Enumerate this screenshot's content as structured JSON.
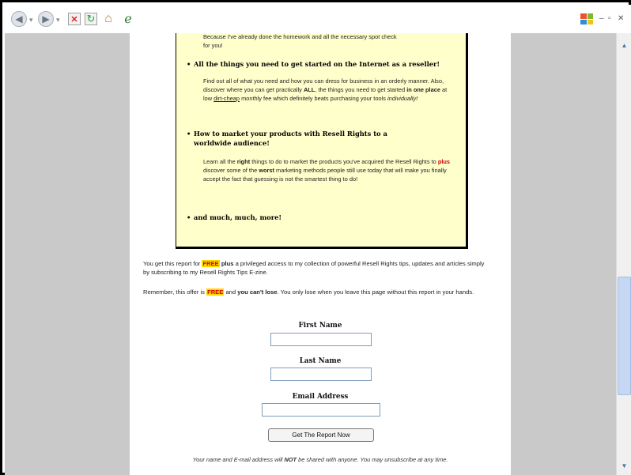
{
  "browser": {
    "back_glyph": "◀",
    "back_arrow": "▾",
    "forward_glyph": "▶",
    "forward_arrow": "▾",
    "stop_glyph": "✕",
    "refresh_glyph": "↻",
    "home_glyph": "⌂",
    "ie_glyph": "ℯ",
    "minimize_glyph": "–",
    "restore_glyph": "▫",
    "close_glyph": "✕",
    "scroll_up_glyph": "▲",
    "scroll_down_glyph": "▼",
    "icons": [
      "back-icon",
      "forward-icon",
      "stop-icon",
      "refresh-icon",
      "home-icon",
      "internet-explorer-icon",
      "windows-logo-icon"
    ],
    "colors": {
      "viewport_bg": "#c9c9c9",
      "scroll_thumb": "#c6d7f4"
    }
  },
  "content": {
    "top_fragment_1": "Because I've already done the homework and all the necessary spot check",
    "top_fragment_2": "for you!",
    "bullet1_title": "All the things you need to get started on the Internet as a reseller!",
    "bullet1_text_a": "Find out all of what you need and how you can dress for business in an orderly manner. Also, discover where you can get practically",
    "bullet1_all": "ALL",
    "bullet1_text_b": "the things you need to get started",
    "bullet1_one_place": "in one place",
    "bullet1_text_c": "at low",
    "bullet1_dirt_cheap": "dirt-cheap",
    "bullet1_text_d": "monthly fee which definitely beats purchasing your tools",
    "bullet1_individually": "individually!",
    "bullet2_title": "How to market your products with Resell Rights to a worldwide audience!",
    "bullet2_text_a": "Learn all the",
    "bullet2_right": "right",
    "bullet2_text_b": "things to do to market the products you've acquired the Resell Rights to",
    "bullet2_plus": "plus",
    "bullet2_text_c": "discover some of the",
    "bullet2_worst": "worst",
    "bullet2_text_d": "marketing methods people still use today that will make you finally accept the fact that guessing is not the smartest thing to do!",
    "bullet3_title": "and much, much, more!",
    "para1_a": "You get this report for",
    "para1_free": "FREE",
    "para1_plus": "plus",
    "para1_b": "a privileged access to my collection of powerful Resell Rights tips, updates and articles simply by subscribing to my Resell Rights Tips E-zine.",
    "para2_a": "Remember, this offer is",
    "para2_free": "FREE",
    "para2_and": "and",
    "para2_cant_lose": "you can't lose",
    "para2_b": ". You only lose when you leave this page without this report in your hands."
  },
  "form": {
    "first_name_label": "First Name",
    "first_name_value": "",
    "last_name_label": "Last Name",
    "last_name_value": "",
    "email_label": "Email Address",
    "email_value": "",
    "submit_label": "Get The Report Now",
    "privacy_a": "Your name and E-mail address will",
    "privacy_not": "NOT",
    "privacy_b": "be shared with anyone. You may unsubscribe at any time."
  }
}
